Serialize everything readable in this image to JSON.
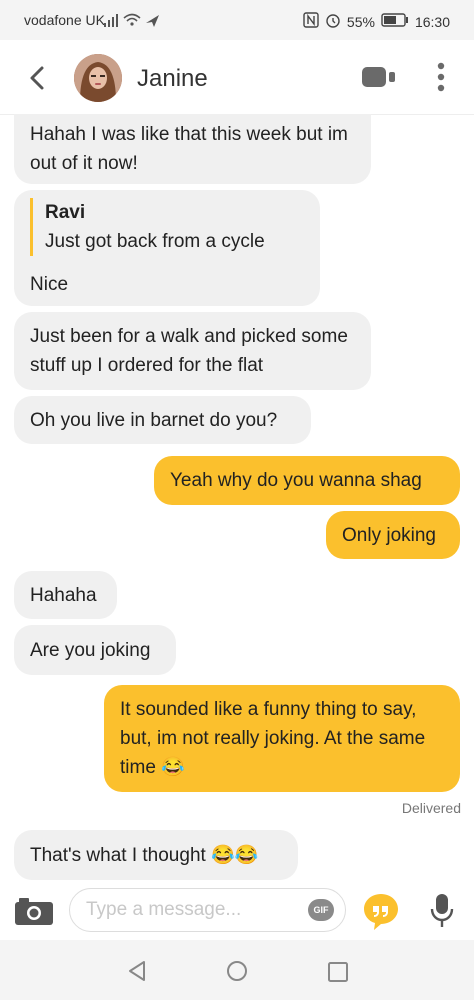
{
  "status": {
    "carrier": "vodafone UK",
    "battery": "55%",
    "time": "16:30"
  },
  "header": {
    "contact_name": "Janine"
  },
  "messages": [
    {
      "dir": "in",
      "text": "Hahah I was like that this week but im out of it now!"
    },
    {
      "dir": "in",
      "quote_name": "Ravi",
      "quote_text": "Just got back from a cycle",
      "text": "Nice"
    },
    {
      "dir": "in",
      "text": "Just been for a walk and picked some stuff up I ordered for the flat"
    },
    {
      "dir": "in",
      "text": "Oh you live in barnet do you?"
    },
    {
      "dir": "out",
      "text": "Yeah why do you wanna shag"
    },
    {
      "dir": "out",
      "text": "Only joking"
    },
    {
      "dir": "in",
      "text": "Hahaha"
    },
    {
      "dir": "in",
      "text": "Are you joking"
    },
    {
      "dir": "out",
      "text": "It sounded like a funny thing to say, but, im not really joking. At the same time 😂"
    },
    {
      "dir": "in",
      "text": "That's what I thought 😂😂"
    }
  ],
  "delivered_label": "Delivered",
  "composer": {
    "placeholder": "Type a message...",
    "gif_label": "GIF"
  },
  "icons": {
    "back": "chevron-left-icon",
    "video": "video-camera-icon",
    "more": "more-vertical-icon",
    "camera": "camera-icon",
    "gif": "gif-icon",
    "quote": "quote-icon",
    "mic": "microphone-icon"
  },
  "colors": {
    "accent": "#fbc02d",
    "incoming_bubble": "#f0f0f0"
  }
}
